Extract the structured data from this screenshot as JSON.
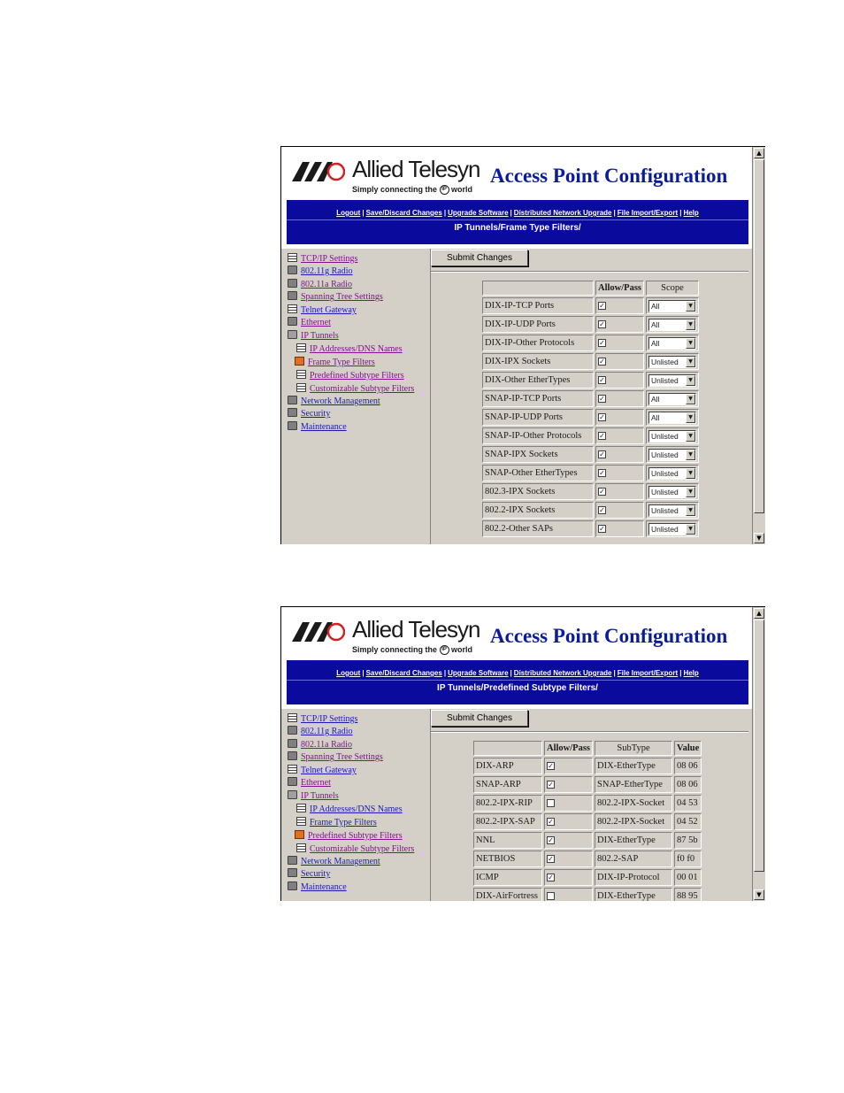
{
  "brand": {
    "name": "Allied Telesyn",
    "tagline_before": "Simply connecting the",
    "tagline_badge": "IP",
    "tagline_after": "world",
    "app_title": "Access Point Configuration"
  },
  "nav": {
    "logout": "Logout",
    "save_discard": "Save/Discard Changes",
    "upgrade": "Upgrade Software",
    "distributed": "Distributed Network Upgrade",
    "file_import": "File Import/Export",
    "help": "Help"
  },
  "submit_label": "Submit Changes",
  "sidebar": {
    "tcpip": "TCP/IP Settings",
    "radio_g": "802.11g Radio",
    "radio_a": "802.11a Radio",
    "spanning": "Spanning Tree Settings",
    "telnet": "Telnet Gateway",
    "ethernet": "Ethernet",
    "ip_tunnels": "IP Tunnels",
    "ip_addresses": "IP Addresses/DNS Names",
    "frame_type": "Frame Type Filters",
    "predefined": "Predefined Subtype Filters",
    "customizable": "Customizable Subtype Filters",
    "network_mgmt": "Network Management",
    "security": "Security",
    "maintenance": "Maintenance"
  },
  "screen1": {
    "breadcrumb": "IP Tunnels/Frame Type Filters/",
    "headers": {
      "allow": "Allow/Pass",
      "scope": "Scope"
    },
    "rows": [
      {
        "name": "DIX-IP-TCP Ports",
        "allow": "✓",
        "scope": "All"
      },
      {
        "name": "DIX-IP-UDP Ports",
        "allow": "✓",
        "scope": "All"
      },
      {
        "name": "DIX-IP-Other Protocols",
        "allow": "✓",
        "scope": "All"
      },
      {
        "name": "DIX-IPX Sockets",
        "allow": "✓",
        "scope": "Unlisted"
      },
      {
        "name": "DIX-Other EtherTypes",
        "allow": "✓",
        "scope": "Unlisted"
      },
      {
        "name": "SNAP-IP-TCP Ports",
        "allow": "✓",
        "scope": "All"
      },
      {
        "name": "SNAP-IP-UDP Ports",
        "allow": "✓",
        "scope": "All"
      },
      {
        "name": "SNAP-IP-Other Protocols",
        "allow": "✓",
        "scope": "Unlisted"
      },
      {
        "name": "SNAP-IPX Sockets",
        "allow": "✓",
        "scope": "Unlisted"
      },
      {
        "name": "SNAP-Other EtherTypes",
        "allow": "✓",
        "scope": "Unlisted"
      },
      {
        "name": "802.3-IPX Sockets",
        "allow": "✓",
        "scope": "Unlisted"
      },
      {
        "name": "802.2-IPX Sockets",
        "allow": "✓",
        "scope": "Unlisted"
      },
      {
        "name": "802.2-Other SAPs",
        "allow": "✓",
        "scope": "Unlisted"
      }
    ]
  },
  "screen2": {
    "breadcrumb": "IP Tunnels/Predefined Subtype Filters/",
    "headers": {
      "allow": "Allow/Pass",
      "subtype": "SubType",
      "value": "Value"
    },
    "rows": [
      {
        "name": "DIX-ARP",
        "allow": "✓",
        "subtype": "DIX-EtherType",
        "value": "08 06"
      },
      {
        "name": "SNAP-ARP",
        "allow": "✓",
        "subtype": "SNAP-EtherType",
        "value": "08 06"
      },
      {
        "name": "802.2-IPX-RIP",
        "allow": "",
        "subtype": "802.2-IPX-Socket",
        "value": "04 53"
      },
      {
        "name": "802.2-IPX-SAP",
        "allow": "✓",
        "subtype": "802.2-IPX-Socket",
        "value": "04 52"
      },
      {
        "name": "NNL",
        "allow": "✓",
        "subtype": "DIX-EtherType",
        "value": "87 5b"
      },
      {
        "name": "NETBIOS",
        "allow": "✓",
        "subtype": "802.2-SAP",
        "value": "f0 f0"
      },
      {
        "name": "ICMP",
        "allow": "✓",
        "subtype": "DIX-IP-Protocol",
        "value": "00 01"
      },
      {
        "name": "DIX-AirFortress",
        "allow": "",
        "subtype": "DIX-EtherType",
        "value": "88 95"
      }
    ]
  },
  "colors": {
    "nav_bg": "#0a0a9c",
    "title": "#0a1c9c",
    "link": "#1a1ab0",
    "visited": "#80108c",
    "panel": "#d4d0c8"
  }
}
